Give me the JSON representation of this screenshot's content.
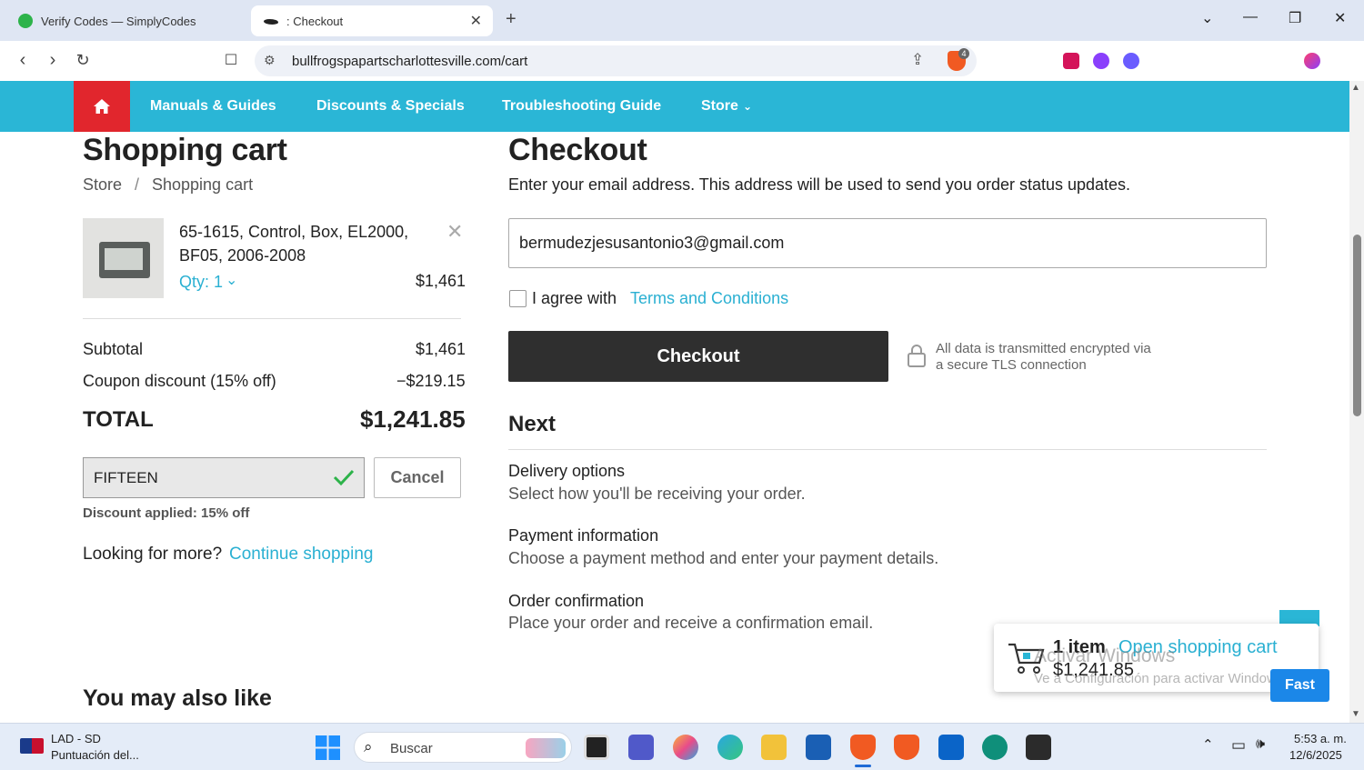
{
  "browser": {
    "tabs": [
      {
        "title": "Verify Codes — SimplyCodes",
        "active": false
      },
      {
        "title": ": Checkout",
        "active": true
      }
    ],
    "url": "bullfrogspapartscharlottesville.com/cart",
    "shield_count": "4"
  },
  "site_nav": {
    "items": [
      "Manuals & Guides",
      "Discounts & Specials",
      "Troubleshooting Guide",
      "Store"
    ]
  },
  "cart": {
    "heading": "Shopping cart",
    "breadcrumb": [
      "Store",
      "/",
      "Shopping cart"
    ],
    "item": {
      "name": "65-1615, Control, Box, EL2000, BF05, 2006-2008",
      "qty": "Qty: 1",
      "price": "$1,461"
    },
    "subtotal_label": "Subtotal",
    "subtotal": "$1,461",
    "coupon_label": "Coupon discount (15% off)",
    "coupon_value": "−$219.15",
    "total_label": "TOTAL",
    "total": "$1,241.85",
    "coupon_code": "FIFTEEN",
    "cancel_label": "Cancel",
    "discount_note": "Discount applied: 15% off",
    "more_text": "Looking for more?",
    "continue_link": "Continue shopping",
    "also_like": "You may also like"
  },
  "checkout": {
    "heading": "Checkout",
    "instructions": "Enter your email address. This address will be used to send you order status updates.",
    "email": "bermudezjesusantonio3@gmail.com",
    "agree_text": "I agree with",
    "terms_link": "Terms and Conditions",
    "button": "Checkout",
    "secure_line1": "All data is transmitted encrypted via",
    "secure_line2": "a secure TLS connection",
    "next_heading": "Next",
    "steps": [
      {
        "name": "Delivery options",
        "desc": "Select how you'll be receiving your order."
      },
      {
        "name": "Payment information",
        "desc": "Choose a payment method and enter your payment details."
      },
      {
        "name": "Order confirmation",
        "desc": "Place your order and receive a confirmation email."
      }
    ]
  },
  "minicart": {
    "count": "1 item",
    "link": "Open shopping cart",
    "total": "$1,241.85",
    "fast": "Fast"
  },
  "watermark": {
    "line1": "Activar Windows",
    "line2": "Ve a Configuración para activar Windows."
  },
  "taskbar": {
    "widget_title": "LAD - SD",
    "widget_sub": "Puntuación del...",
    "search": "Buscar",
    "time": "5:53 a. m.",
    "date": "12/6/2025"
  },
  "colors": {
    "accent": "#2ab6d6",
    "home": "#e1262d",
    "check": "#2db34a",
    "fast": "#1b87e8"
  }
}
